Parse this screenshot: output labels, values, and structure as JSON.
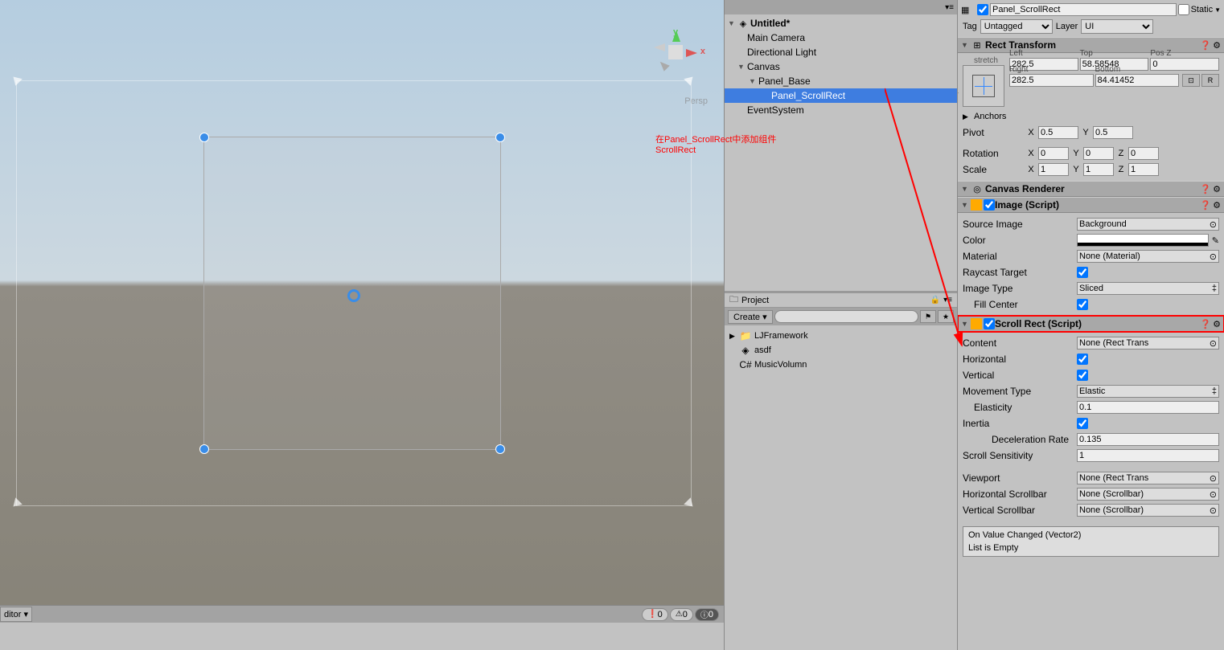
{
  "scene": {
    "perspLabel": "Persp",
    "gizmo_x": "x",
    "gizmo_y": "y"
  },
  "annotation": {
    "line1": "在Panel_ScrollRect中添加组件",
    "line2": "ScrollRect"
  },
  "statusbar": {
    "editor": "ditor ▾",
    "err": "0",
    "warn": "0",
    "inf": "0"
  },
  "hierarchy": {
    "title": "Untitled*",
    "items": [
      {
        "label": "Main Camera",
        "indent": 28
      },
      {
        "label": "Directional Light",
        "indent": 28
      },
      {
        "label": "Canvas",
        "indent": 16,
        "arrow": "▼"
      },
      {
        "label": "Panel_Base",
        "indent": 30,
        "arrow": "▼"
      },
      {
        "label": "Panel_ScrollRect",
        "indent": 58,
        "selected": true
      },
      {
        "label": "EventSystem",
        "indent": 28
      }
    ]
  },
  "project": {
    "tab": "Project",
    "create": "Create ▾",
    "searchPlaceholder": "",
    "items": [
      {
        "label": "LJFramework",
        "icon": "📁",
        "arrow": "▶"
      },
      {
        "label": "asdf",
        "icon": "◈"
      },
      {
        "label": "MusicVolumn",
        "icon": "C#"
      }
    ]
  },
  "inspector": {
    "name": "Panel_ScrollRect",
    "static": "Static",
    "tagLabel": "Tag",
    "tag": "Untagged",
    "layerLabel": "Layer",
    "layer": "UI",
    "rectTransform": {
      "title": "Rect Transform",
      "stretch": "stretch",
      "left": "Left",
      "leftV": "282.5",
      "top": "Top",
      "topV": "58.58548",
      "posz": "Pos Z",
      "poszV": "0",
      "right": "Right",
      "rightV": "282.5",
      "bottom": "Bottom",
      "bottomV": "84.41452",
      "anchors": "Anchors",
      "pivot": "Pivot",
      "pivotX": "0.5",
      "pivotY": "0.5",
      "rotation": "Rotation",
      "rotX": "0",
      "rotY": "0",
      "rotZ": "0",
      "scale": "Scale",
      "sclX": "1",
      "sclY": "1",
      "sclZ": "1",
      "rBtn": "R"
    },
    "canvasRenderer": {
      "title": "Canvas Renderer"
    },
    "image": {
      "title": "Image (Script)",
      "sourceImage": "Source Image",
      "sourceImageV": "Background",
      "color": "Color",
      "material": "Material",
      "materialV": "None (Material)",
      "raycast": "Raycast Target",
      "imageType": "Image Type",
      "imageTypeV": "Sliced",
      "fillCenter": "Fill Center"
    },
    "scrollRect": {
      "title": "Scroll Rect (Script)",
      "content": "Content",
      "contentV": "None (Rect Trans",
      "horizontal": "Horizontal",
      "vertical": "Vertical",
      "movementType": "Movement Type",
      "movementTypeV": "Elastic",
      "elasticity": "Elasticity",
      "elasticityV": "0.1",
      "inertia": "Inertia",
      "deceleration": "Deceleration Rate",
      "decelerationV": "0.135",
      "sensitivity": "Scroll Sensitivity",
      "sensitivityV": "1",
      "viewport": "Viewport",
      "viewportV": "None (Rect Trans",
      "hScrollbar": "Horizontal Scrollbar",
      "hScrollbarV": "None (Scrollbar)",
      "vScrollbar": "Vertical Scrollbar",
      "vScrollbarV": "None (Scrollbar)",
      "event": "On Value Changed (Vector2)",
      "eventEmpty": "List is Empty"
    }
  }
}
